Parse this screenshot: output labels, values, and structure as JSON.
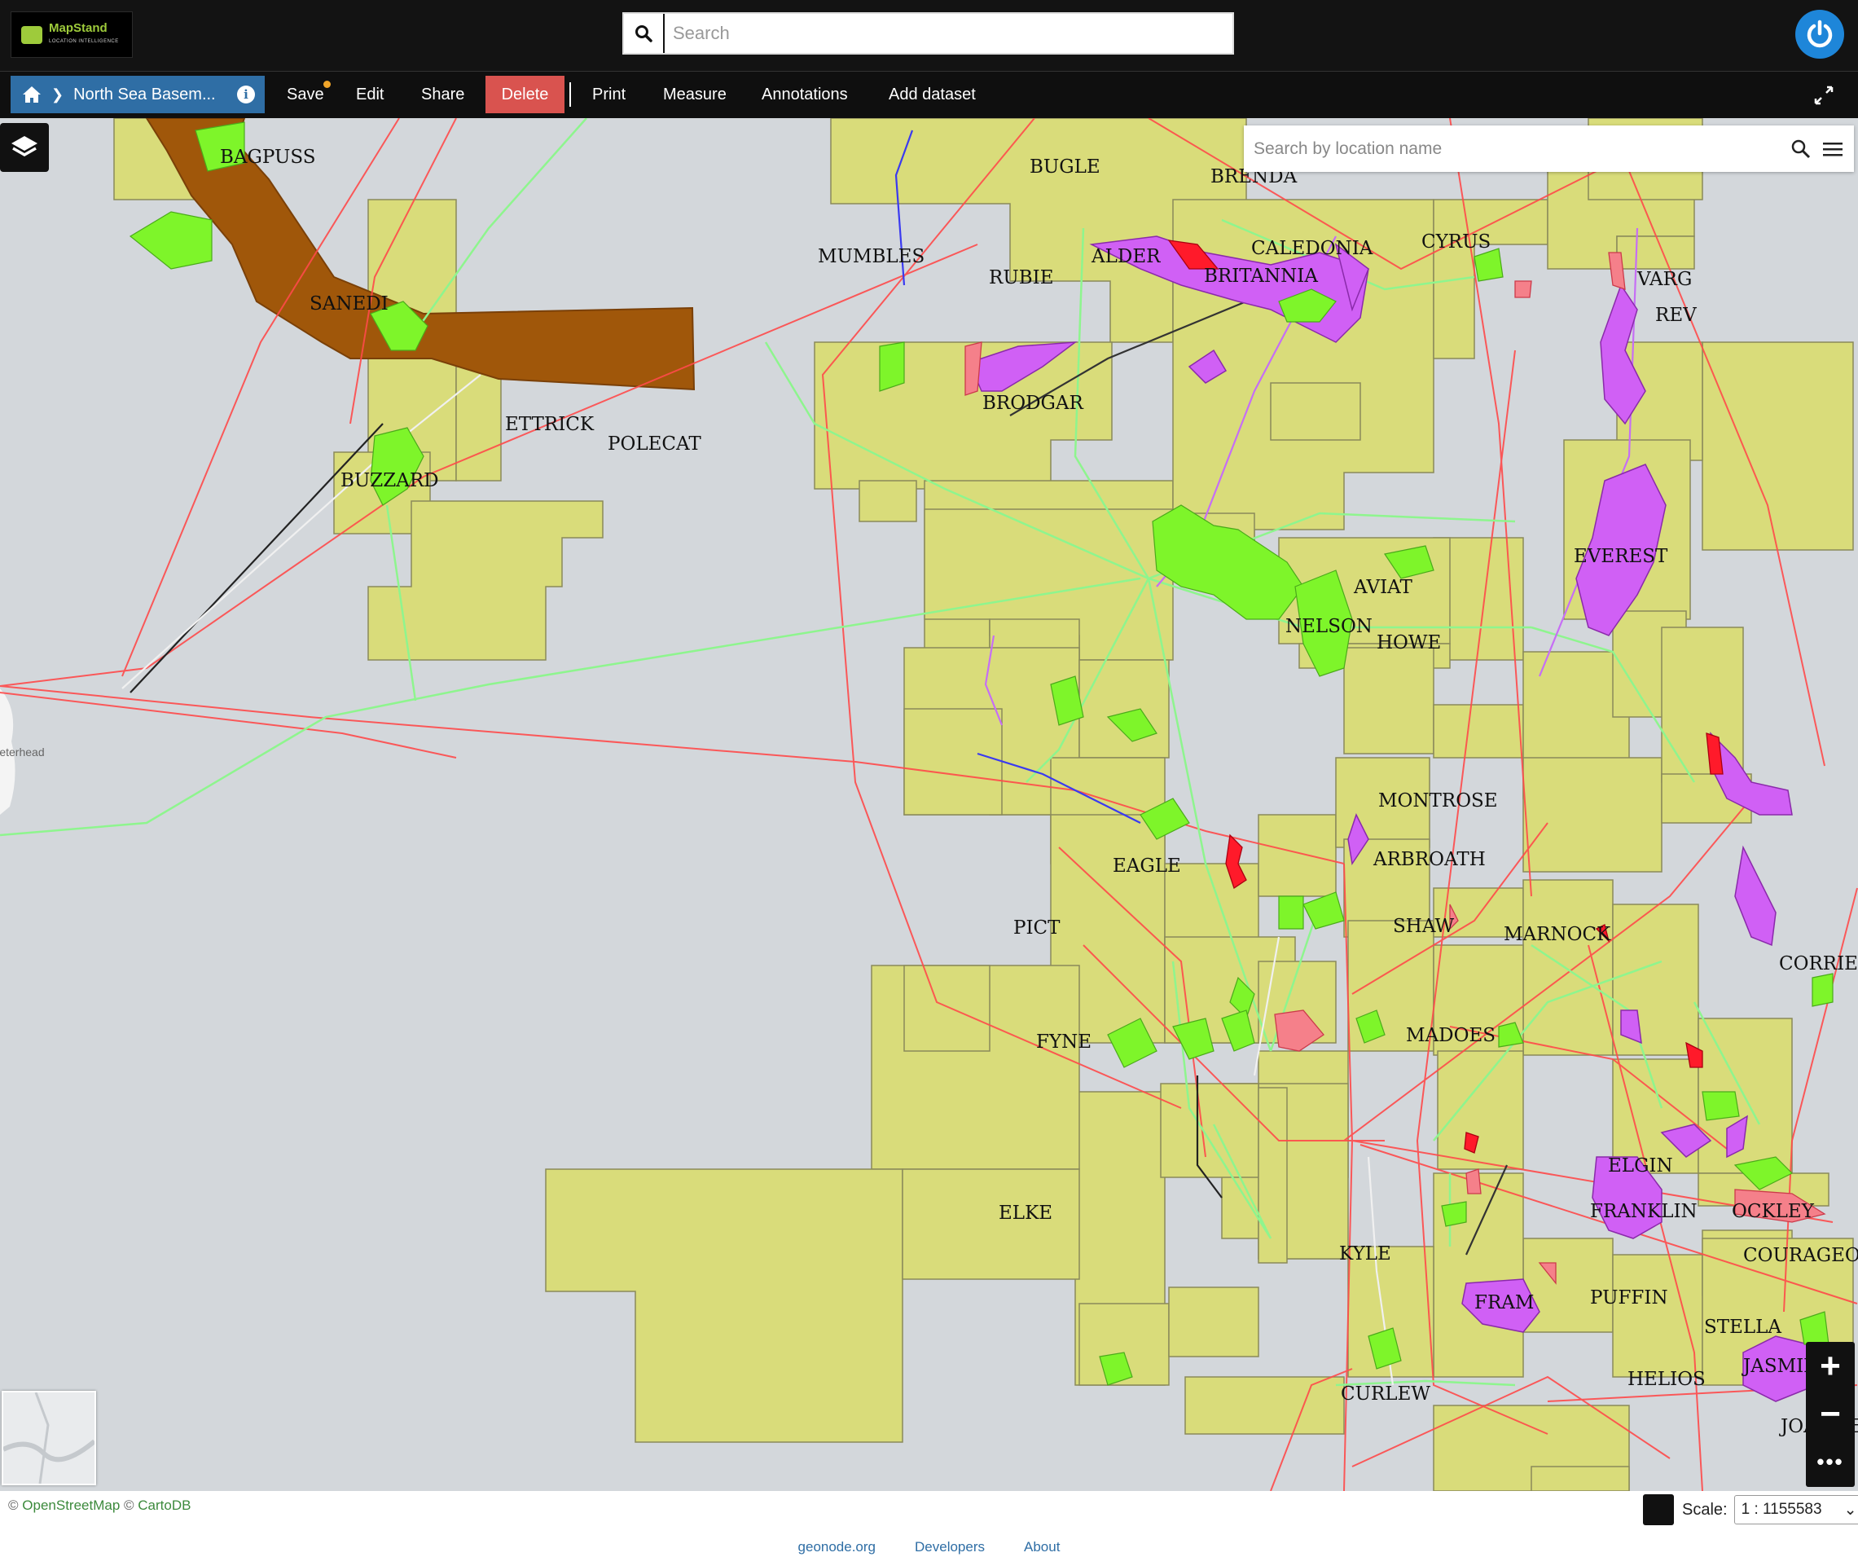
{
  "app": {
    "logo_name": "MapStand",
    "logo_tagline": "LOCATION INTELLIGENCE",
    "search_placeholder": "Search",
    "power_icon": "power-icon"
  },
  "toolbar": {
    "home_icon": "home-icon",
    "map_title": "North Sea Basem...",
    "info_icon": "info-icon",
    "save_label": "Save",
    "edit_label": "Edit",
    "share_label": "Share",
    "delete_label": "Delete",
    "print_label": "Print",
    "measure_label": "Measure",
    "annotations_label": "Annotations",
    "add_dataset_label": "Add dataset",
    "expand_icon": "expand-icon",
    "colors": {
      "accent": "#2f6ea5",
      "danger": "#d9534f",
      "unsaved_dot": "#f0a52a"
    }
  },
  "map": {
    "location_search_placeholder": "Search by location name",
    "field_labels": [
      "BAGPUSS",
      "SANEDI",
      "ETTRICK",
      "POLECAT",
      "BUZZARD",
      "MUMBLES",
      "RUBIE",
      "BUGLE",
      "BRENDA",
      "ALDER",
      "CALEDONIA",
      "BRITANNIA",
      "CYRUS",
      "VARG",
      "REV",
      "BRODGAR",
      "EVEREST",
      "AVIAT",
      "NELSON",
      "HOWE",
      "MONTROSE",
      "ARBROATH",
      "EAGLE",
      "PICT",
      "SHAW",
      "MARNOCK",
      "CORRIE",
      "FYNE",
      "MADOES",
      "ELGIN",
      "FRANKLIN",
      "OCKLEY",
      "ELKE",
      "KYLE",
      "FRAM",
      "PUFFIN",
      "COURAGEOUS",
      "STELLA",
      "JASMINE",
      "HELIOS",
      "CURLEW",
      "JOANNE"
    ],
    "place_labels": [
      "Peterhead"
    ],
    "colors": {
      "sea": "#d3d7db",
      "license_block": "#d9dc7a",
      "oil_field": "#7ef52a",
      "gas_field": "#d060f5",
      "discovery": "#f5808a",
      "restricted_area": "#a0570a",
      "pipeline_red": "#ff4a4a",
      "pipeline_green": "#8ef58e"
    },
    "zoom_in_label": "+",
    "zoom_out_label": "−",
    "more_label": "•••",
    "layers_icon": "layers-icon",
    "search_icon": "magnifier-icon",
    "menu_icon": "hamburger-icon"
  },
  "footer": {
    "attribution_prefix": "©",
    "osm": "OpenStreetMap",
    "carto": "CartoDB",
    "scale_label": "Scale:",
    "scale_value": "1 : 1155583",
    "links": [
      "geonode.org",
      "Developers",
      "About"
    ]
  }
}
